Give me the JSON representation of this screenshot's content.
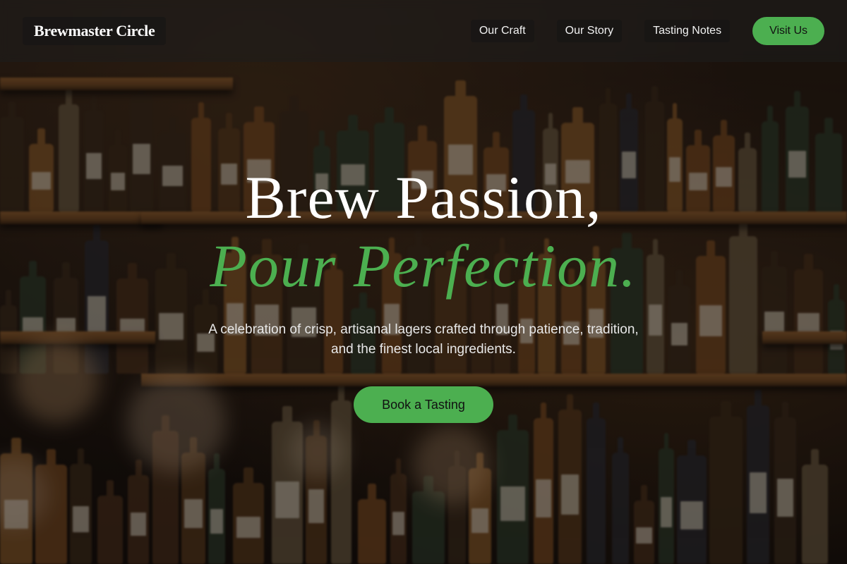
{
  "header": {
    "brand": "Brewmaster Circle",
    "nav": [
      {
        "label": "Our Craft"
      },
      {
        "label": "Our Story"
      },
      {
        "label": "Tasting Notes"
      }
    ],
    "cta_label": "Visit Us"
  },
  "hero": {
    "title_line1": "Brew Passion,",
    "title_line2": "Pour Perfection.",
    "subtitle": "A celebration of crisp, artisanal lagers crafted through patience, tradition, and the finest local ingredients.",
    "cta_label": "Book a Tasting"
  },
  "colors": {
    "accent": "#4caf50",
    "text": "#ffffff",
    "header_bg": "#1e1e1e"
  }
}
